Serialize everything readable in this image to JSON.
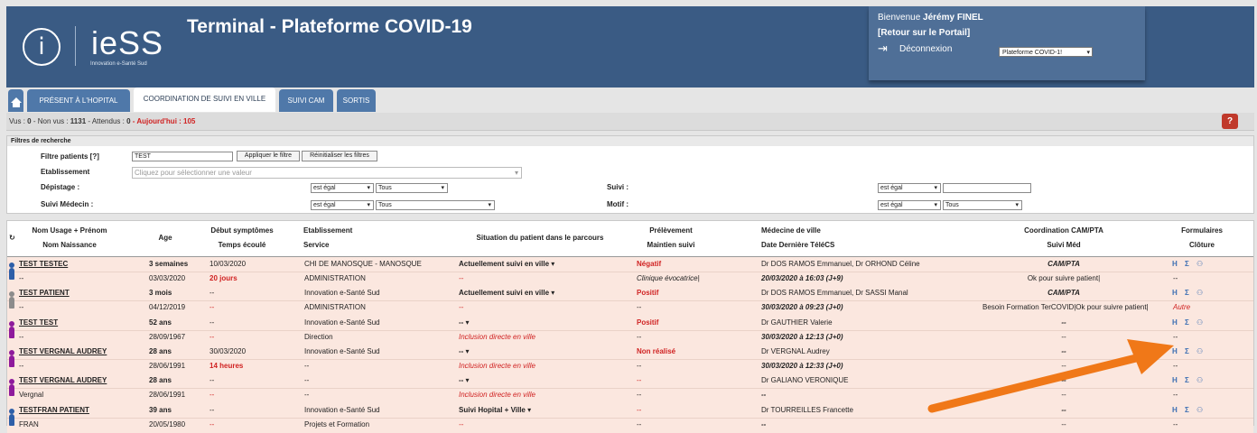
{
  "header": {
    "logo_text": "ieSS",
    "logo_i": "i",
    "logo_sub": "Innovation e-Santé Sud",
    "title": "Terminal - Plateforme COVID-19",
    "welcome_prefix": "Bienvenue",
    "user_name": "Jérémy FINEL",
    "portal_link": "[Retour sur le Portail]",
    "logout_label": "Déconnexion",
    "platform_select": "Plateforme COVID-1!"
  },
  "tabs": [
    "PRÉSENT À L'HOPITAL",
    "COORDINATION DE SUIVI EN VILLE",
    "SUIVI CAM",
    "SORTIS"
  ],
  "status": {
    "vus_label": "Vus :",
    "vus": "0",
    "nonvus_label": "- Non vus :",
    "nonvus": "1131",
    "attendus_label": "- Attendus :",
    "attendus": "0",
    "today": "- Aujourd'hui : 105"
  },
  "filters": {
    "title": "Filtres de recherche",
    "patients_label": "Filtre patients [?]",
    "patients_value": "TEST",
    "apply_btn": "Appliquer le filtre",
    "reset_btn": "Réinitialiser les filtres",
    "estab_label": "Etablissement",
    "estab_placeholder": "Cliquez pour sélectionner une valeur",
    "depistage_label": "Dépistage :",
    "depistage_op": "est égal",
    "depistage_val": "Tous",
    "suivi_medecin_label": "Suivi Médecin :",
    "suivi_medecin_op": "est égal",
    "suivi_medecin_val": "Tous",
    "suivi_label": "Suivi :",
    "suivi_op": "est égal",
    "motif_label": "Motif :",
    "motif_op": "est égal",
    "motif_val": "Tous"
  },
  "table": {
    "headers": {
      "name1": "Nom Usage + Prénom",
      "name2": "Nom Naissance",
      "age": "Age",
      "debut": "Début symptômes",
      "temps": "Temps écoulé",
      "etab": "Etablissement",
      "service": "Service",
      "situation": "Situation du patient dans le parcours",
      "prelev": "Prélèvement",
      "maintien": "Maintien suivi",
      "medecin": "Médecine de ville",
      "telecs": "Date Dernière TéléCS",
      "coord": "Coordination CAM/PTA",
      "suivimed": "Suivi Méd",
      "form": "Formulaires",
      "cloture": "Clôture"
    },
    "rows": [
      {
        "name": "TEST TESTEC",
        "birth_name": "--",
        "age": "3 semaines",
        "debut": "10/03/2020",
        "dob": "03/03/2020",
        "temps": "20 jours",
        "etab": "CHI DE MANOSQUE - MANOSQUE",
        "service": "ADMINISTRATION",
        "situation": "Actuellement suivi en ville ▾",
        "situation2": "--",
        "prelev": "Négatif",
        "maintien": "Clinique évocatrice|",
        "medecin": "Dr DOS RAMOS Emmanuel, Dr ORHOND Céline",
        "telecs": "20/03/2020 à 16:03 (J+9)",
        "coord": "CAM/PTA",
        "suivimed": "Ok pour suivre patient|",
        "forms": "H Σ ⚇",
        "cloture": "--",
        "person_color": "#2e5fa8"
      },
      {
        "name": "TEST PATIENT",
        "birth_name": "--",
        "age": "3 mois",
        "debut": "--",
        "dob": "04/12/2019",
        "temps": "--",
        "etab": "Innovation e-Santé Sud",
        "service": "ADMINISTRATION",
        "situation": "Actuellement suivi en ville ▾",
        "situation2": "--",
        "prelev": "Positif",
        "maintien": "--",
        "medecin": "Dr DOS RAMOS Emmanuel, Dr SASSI Manal",
        "telecs": "30/03/2020 à 09:23 (J+0)",
        "coord": "CAM/PTA",
        "suivimed": "Besoin Formation TerCOVID|Ok pour suivre patient|",
        "forms": "H Σ ⚇",
        "cloture": "Autre",
        "person_color": "#8c8c8c"
      },
      {
        "name": "TEST TEST",
        "birth_name": "--",
        "age": "52 ans",
        "debut": "--",
        "dob": "28/09/1967",
        "temps": "--",
        "etab": "Innovation e-Santé Sud",
        "service": "Direction",
        "situation": "-- ▾",
        "situation2": "Inclusion directe en ville",
        "prelev": "Positif",
        "maintien": "--",
        "medecin": "Dr GAUTHIER Valerie",
        "telecs": "30/03/2020 à 12:13 (J+0)",
        "coord": "--",
        "suivimed": "--",
        "forms": "H Σ ⚇",
        "cloture": "--",
        "person_color": "#8e1a9c"
      },
      {
        "name": "TEST VERGNAL AUDREY",
        "birth_name": "--",
        "age": "28 ans",
        "debut": "30/03/2020",
        "dob": "28/06/1991",
        "temps": "14 heures",
        "etab": "Innovation e-Santé Sud",
        "service": "--",
        "situation": "-- ▾",
        "situation2": "Inclusion directe en ville",
        "prelev": "Non réalisé",
        "maintien": "--",
        "medecin": "Dr VERGNAL Audrey",
        "telecs": "30/03/2020 à 12:33 (J+0)",
        "coord": "--",
        "suivimed": "--",
        "forms": "H Σ ⚇",
        "cloture": "--",
        "person_color": "#8e1a9c"
      },
      {
        "name": "TEST VERGNAL AUDREY",
        "birth_name": "Vergnal",
        "age": "28 ans",
        "debut": "--",
        "dob": "28/06/1991",
        "temps": "--",
        "etab": "--",
        "service": "--",
        "situation": "-- ▾",
        "situation2": "Inclusion directe en ville",
        "prelev": "--",
        "maintien": "--",
        "medecin": "Dr GALIANO VERONIQUE",
        "telecs": "--",
        "coord": "--",
        "suivimed": "--",
        "forms": "H Σ ⚇",
        "cloture": "--",
        "person_color": "#8e1a9c"
      },
      {
        "name": "TESTFRAN PATIENT",
        "birth_name": "FRAN",
        "age": "39 ans",
        "debut": "--",
        "dob": "20/05/1980",
        "temps": "--",
        "etab": "Innovation e-Santé Sud",
        "service": "Projets et Formation",
        "situation": "Suivi Hopital + Ville ▾",
        "situation2": "--",
        "prelev": "--",
        "maintien": "--",
        "medecin": "Dr TOURREILLES Francette",
        "telecs": "--",
        "coord": "--",
        "suivimed": "--",
        "forms": "H Σ ⚇",
        "cloture": "--",
        "person_color": "#2e5fa8"
      }
    ]
  },
  "colors": {
    "banner": "#3a5b84",
    "tab": "#4f78a9",
    "row_bg": "#fbe7df",
    "red": "#d02222",
    "arrow": "#f07818"
  }
}
